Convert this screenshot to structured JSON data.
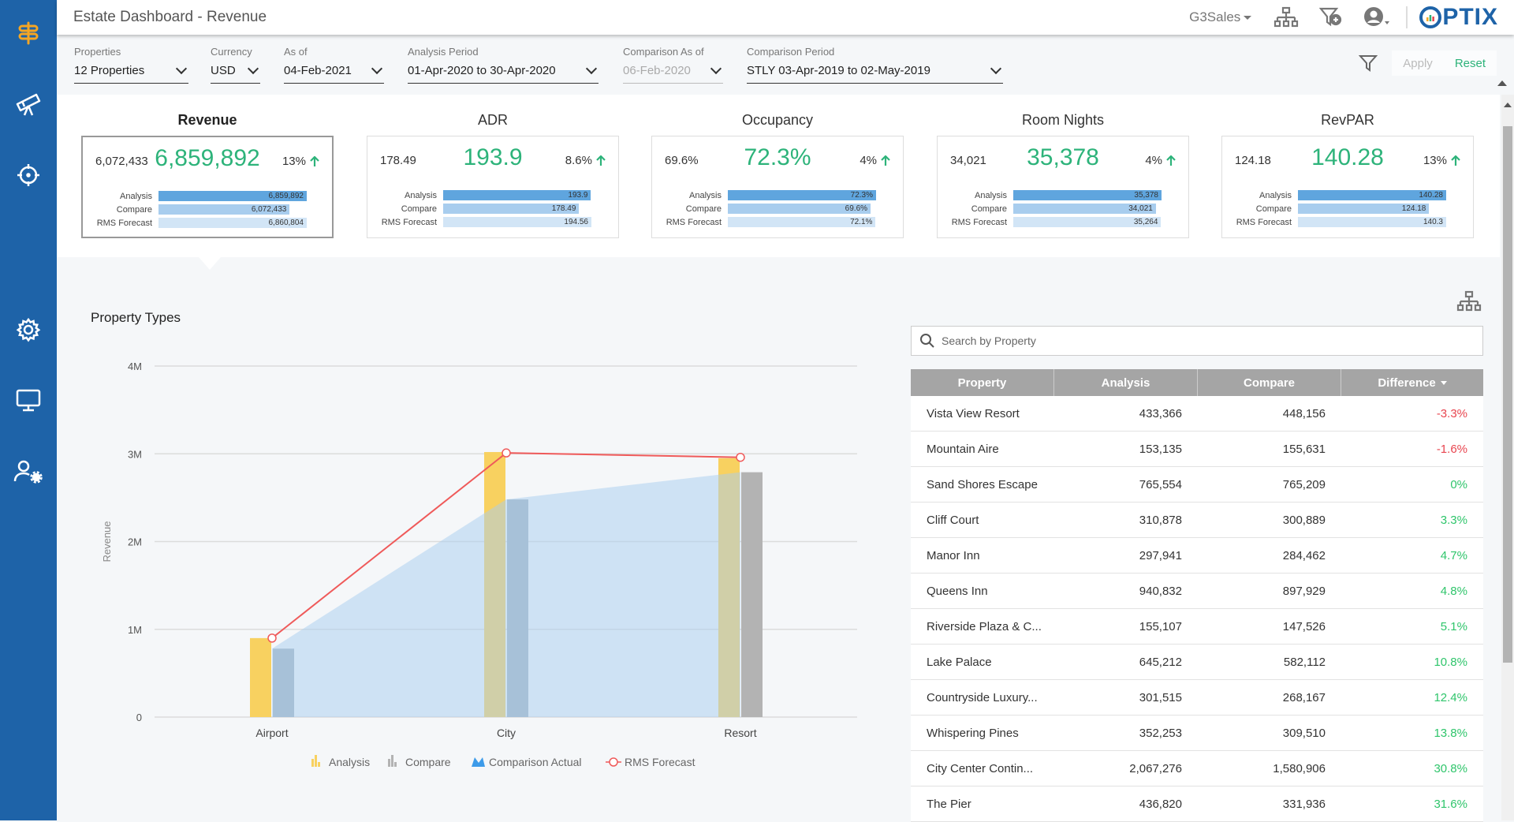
{
  "header": {
    "title": "Estate Dashboard - Revenue",
    "user_menu_label": "G3Sales",
    "logo_text": "PTIX"
  },
  "filters": {
    "properties": {
      "label": "Properties",
      "value": "12 Properties"
    },
    "currency": {
      "label": "Currency",
      "value": "USD"
    },
    "as_of": {
      "label": "As of",
      "value": "04-Feb-2021"
    },
    "analysis_period": {
      "label": "Analysis Period",
      "value": "01-Apr-2020 to 30-Apr-2020"
    },
    "comparison_as_of": {
      "label": "Comparison As of",
      "value": "06-Feb-2020"
    },
    "comparison_period": {
      "label": "Comparison Period",
      "value": "STLY 03-Apr-2019 to 02-May-2019"
    },
    "apply_label": "Apply",
    "reset_label": "Reset"
  },
  "kpis": [
    {
      "title": "Revenue",
      "compare": "6,072,433",
      "main": "6,859,892",
      "pct": "13%",
      "active": true,
      "rows": [
        {
          "label": "Analysis",
          "value": "6,859,892",
          "fill": 1.0
        },
        {
          "label": "Compare",
          "value": "6,072,433",
          "fill": 0.885
        },
        {
          "label": "RMS Forecast",
          "value": "6,860,804",
          "fill": 1.0
        }
      ]
    },
    {
      "title": "ADR",
      "compare": "178.49",
      "main": "193.9",
      "pct": "8.6%",
      "rows": [
        {
          "label": "Analysis",
          "value": "193.9",
          "fill": 0.997
        },
        {
          "label": "Compare",
          "value": "178.49",
          "fill": 0.917
        },
        {
          "label": "RMS Forecast",
          "value": "194.56",
          "fill": 1.0
        }
      ]
    },
    {
      "title": "Occupancy",
      "compare": "69.6%",
      "main": "72.3%",
      "pct": "4%",
      "rows": [
        {
          "label": "Analysis",
          "value": "72.3%",
          "fill": 1.0
        },
        {
          "label": "Compare",
          "value": "69.6%",
          "fill": 0.963
        },
        {
          "label": "RMS Forecast",
          "value": "72.1%",
          "fill": 0.997
        }
      ]
    },
    {
      "title": "Room Nights",
      "compare": "34,021",
      "main": "35,378",
      "pct": "4%",
      "rows": [
        {
          "label": "Analysis",
          "value": "35,378",
          "fill": 1.0
        },
        {
          "label": "Compare",
          "value": "34,021",
          "fill": 0.962
        },
        {
          "label": "RMS Forecast",
          "value": "35,264",
          "fill": 0.997
        }
      ]
    },
    {
      "title": "RevPAR",
      "compare": "124.18",
      "main": "140.28",
      "pct": "13%",
      "rows": [
        {
          "label": "Analysis",
          "value": "140.28",
          "fill": 1.0
        },
        {
          "label": "Compare",
          "value": "124.18",
          "fill": 0.885
        },
        {
          "label": "RMS Forecast",
          "value": "140.3",
          "fill": 1.0
        }
      ]
    }
  ],
  "colors": {
    "positive": "#2db37a",
    "negative": "#e8454f",
    "sidebar": "#1e63a8",
    "logo_accent": "#f5a623"
  },
  "chart_data": {
    "type": "bar",
    "title": "Property Types",
    "xlabel": "",
    "ylabel": "Revenue",
    "ylim": [
      0,
      4000000
    ],
    "yticks": [
      0,
      1000000,
      2000000,
      3000000,
      4000000
    ],
    "ytick_labels": [
      "0",
      "1M",
      "2M",
      "3M",
      "4M"
    ],
    "categories": [
      "Airport",
      "City",
      "Resort"
    ],
    "grid": true,
    "legend_position": "bottom",
    "series": [
      {
        "name": "Analysis",
        "kind": "bar",
        "color": "#f8d160",
        "values": [
          900000,
          3020000,
          2950000
        ]
      },
      {
        "name": "Compare",
        "kind": "bar",
        "color": "#a6b4c0",
        "values": [
          780000,
          2480000,
          2790000
        ]
      },
      {
        "name": "Comparison Actual",
        "kind": "area",
        "color": "#cfe5f7",
        "values": [
          780000,
          2480000,
          2790000
        ]
      },
      {
        "name": "RMS Forecast",
        "kind": "line",
        "color": "#ef5a5a",
        "values": [
          900000,
          3010000,
          2960000
        ]
      }
    ]
  },
  "search": {
    "placeholder": "Search by Property",
    "value": ""
  },
  "table": {
    "columns": [
      "Property",
      "Analysis",
      "Compare",
      "Difference"
    ],
    "rows": [
      {
        "property": "Vista View Resort",
        "analysis": "433,366",
        "compare": "448,156",
        "difference": "-3.3%",
        "sign": "neg"
      },
      {
        "property": "Mountain Aire",
        "analysis": "153,135",
        "compare": "155,631",
        "difference": "-1.6%",
        "sign": "neg"
      },
      {
        "property": "Sand Shores Escape",
        "analysis": "765,554",
        "compare": "765,209",
        "difference": "0%",
        "sign": "pos"
      },
      {
        "property": "Cliff Court",
        "analysis": "310,878",
        "compare": "300,889",
        "difference": "3.3%",
        "sign": "pos"
      },
      {
        "property": "Manor Inn",
        "analysis": "297,941",
        "compare": "284,462",
        "difference": "4.7%",
        "sign": "pos"
      },
      {
        "property": "Queens Inn",
        "analysis": "940,832",
        "compare": "897,929",
        "difference": "4.8%",
        "sign": "pos"
      },
      {
        "property": "Riverside Plaza & C...",
        "analysis": "155,107",
        "compare": "147,526",
        "difference": "5.1%",
        "sign": "pos"
      },
      {
        "property": "Lake Palace",
        "analysis": "645,212",
        "compare": "582,112",
        "difference": "10.8%",
        "sign": "pos"
      },
      {
        "property": "Countryside Luxury...",
        "analysis": "301,515",
        "compare": "268,167",
        "difference": "12.4%",
        "sign": "pos"
      },
      {
        "property": "Whispering Pines",
        "analysis": "352,253",
        "compare": "309,510",
        "difference": "13.8%",
        "sign": "pos"
      },
      {
        "property": "City Center Contin...",
        "analysis": "2,067,276",
        "compare": "1,580,906",
        "difference": "30.8%",
        "sign": "pos"
      },
      {
        "property": "The Pier",
        "analysis": "436,820",
        "compare": "331,936",
        "difference": "31.6%",
        "sign": "pos"
      }
    ]
  }
}
